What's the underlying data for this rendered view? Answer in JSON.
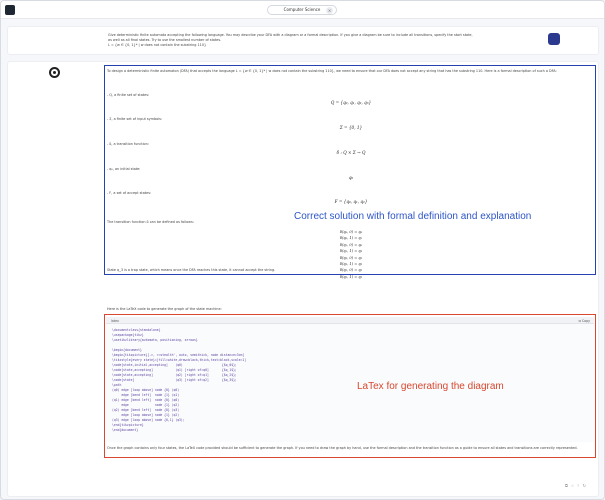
{
  "header": {
    "app_logo": "logo",
    "topic": "Computer Science",
    "close_glyph": "×"
  },
  "prompt": {
    "line1": "Give deterministic finite automata accepting the following language. You may describe your DFA with a diagram or a formal description. If you give a diagram be sure to include all transitions, specify the start state,",
    "line2": "as well as all final states. Try to use the smallest number of states.",
    "line3": "L = {w ∈ {0, 1}* | w does not contain the substring 110}",
    "avatar": "ML"
  },
  "response": {
    "intro": "To design a deterministic finite automaton (DFA) that accepts the language L = {w ∈ {0, 1}* | w does not contain the substring 110}, we need to ensure that our DFA does not accept any string that has the substring 110. Here is a formal description of such a DFA:",
    "q_label": "- Q, a finite set of states:",
    "q_math": "Q = {q₀, q₁, q₂, q₃}",
    "sigma_label": "- Σ, a finite set of input symbols:",
    "sigma_math": "Σ = {0, 1}",
    "delta_label": "- δ, a transition function:",
    "delta_math": "δ : Q × Σ → Q",
    "q0_label": "- q₀, an initial state:",
    "q0_math": "q₀",
    "f_label": "- F, a set of accept states:",
    "f_math": "F = {q₀, q₁, q₂}",
    "trans_intro": "The transition function δ can be defined as follows:",
    "transitions": [
      "δ(q₀, 0) = q₀",
      "δ(q₀, 1) = q₁",
      "δ(q₁, 0) = q₀",
      "δ(q₁, 1) = q₂",
      "δ(q₂, 0) = q₃",
      "δ(q₂, 1) = q₂",
      "δ(q₃, 0) = q₃",
      "δ(q₃, 1) = q₃"
    ],
    "trap_note": "State q_3 is a trap state, which means once the DFA reaches this state, it cannot accept the string.",
    "latex_intro": "Here is the LaTeX code to generate the graph of the state machine:",
    "code_lang": "latex",
    "copy_label": "⧉ Copy",
    "code_lines": [
      "\\documentclass{standalone}",
      "\\usepackage{tikz}",
      "\\usetikzlibrary{automata, positioning, arrows}",
      "",
      "\\begin{document}",
      "\\begin{tikzpicture}[->, >=stealth', auto, semithick, node distance=3cm]",
      "\\tikzstyle{every state}=[fill=white,draw=black,thick,text=black,scale=1]",
      "\\node[state,initial,accepting]    (q0)                     {$q_0$};",
      "\\node[state,accepting]            (q1) [right of=q0]       {$q_1$};",
      "\\node[state,accepting]            (q2) [right of=q1]       {$q_2$};",
      "\\node[state]                      (q3) [right of=q2]       {$q_3$};",
      "\\path",
      "(q0) edge [loop above] node {0} (q0)",
      "     edge [bend left]  node {1} (q1)",
      "(q1) edge [bend left]  node {0} (q0)",
      "     edge              node {1} (q2)",
      "(q2) edge [bend left]  node {0} (q3)",
      "     edge [loop above] node {1} (q2)",
      "(q3) edge [loop above] node {0,1} (q3);",
      "\\end{tikzpicture}",
      "\\end{document}"
    ],
    "closing1": "Once the graph contains only four states, the LaTeX code provided should be sufficient to generate the graph. If you need to draw the graph by hand, use the formal description and the transition function as a guide to ensure all states and transitions are correctly",
    "closing2": "represented."
  },
  "annotations": {
    "blue": "Correct solution with formal definition and explanation",
    "red": "LaTex for generating the diagram",
    "blue_color": "#2e55c9",
    "red_color": "#d8472f"
  },
  "footer": {
    "icons": [
      "copy-icon",
      "thumbs-up-icon",
      "thumbs-down-icon",
      "refresh-icon"
    ],
    "glyphs": [
      "⧉",
      "☝",
      "☟",
      "↻"
    ]
  }
}
